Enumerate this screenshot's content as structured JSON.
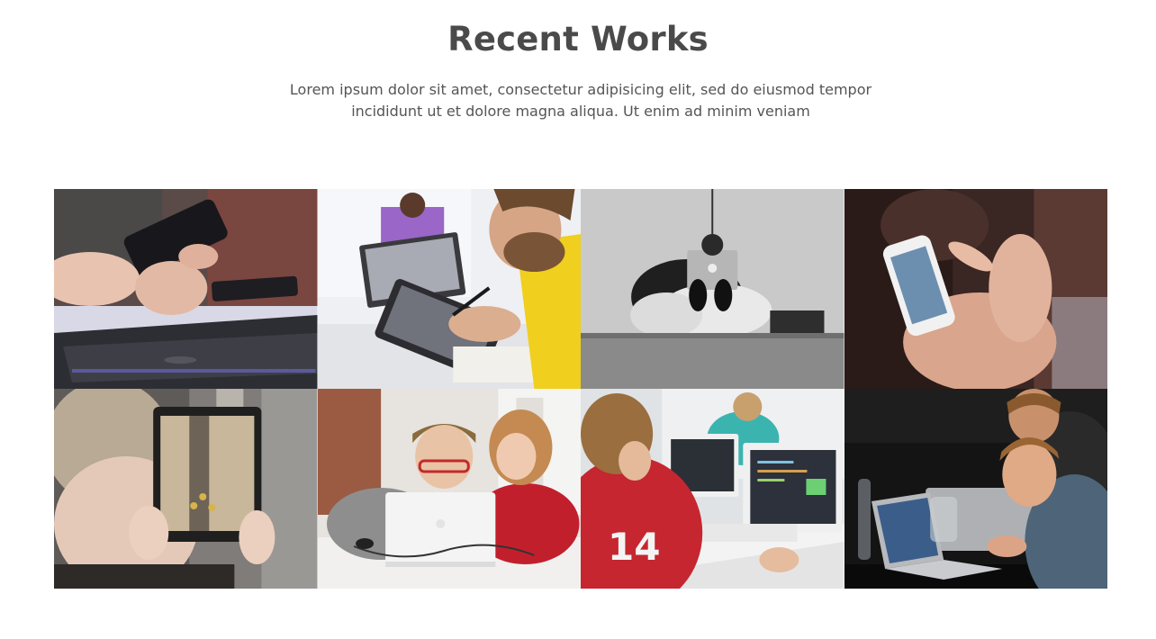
{
  "section": {
    "title": "Recent Works",
    "subtitle": "Lorem ipsum dolor sit amet, consectetur adipisicing elit, sed do eiusmod tempor incididunt ut et dolore magna aliqua. Ut enim ad minim veniam"
  },
  "gallery": {
    "items": [
      {
        "photo": "hands-holding-smartphone-over-tablet"
      },
      {
        "photo": "man-drawing-on-tablet-with-stylus"
      },
      {
        "photo": "person-with-laptop-in-beanbag-grayscale"
      },
      {
        "photo": "hands-using-white-smartphone"
      },
      {
        "photo": "woman-photographing-city-street-with-tablet"
      },
      {
        "photo": "two-kids-at-white-laptop"
      },
      {
        "photo": "boy-in-red-hoodie-coding-on-laptop"
      },
      {
        "photo": "men-working-on-laptops-at-event"
      }
    ]
  },
  "colors": {
    "title": "#4a4a4a",
    "text": "#555555",
    "background": "#ffffff"
  }
}
